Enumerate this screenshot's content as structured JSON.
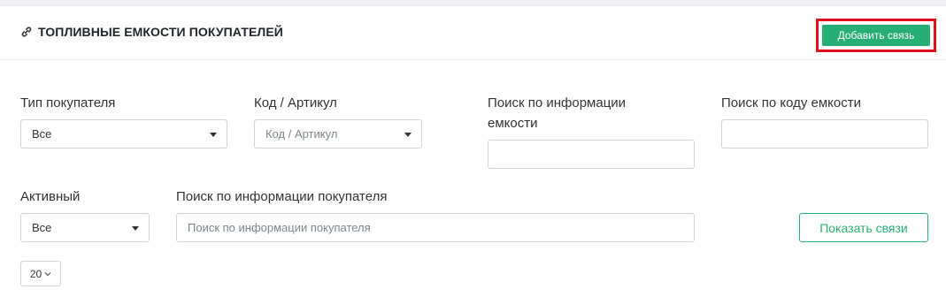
{
  "header": {
    "title": "ТОПЛИВНЫЕ ЕМКОСТИ ПОКУПАТЕЛЕЙ",
    "title_icon": "link-icon",
    "add_button_label": "Добавить связь"
  },
  "filters": {
    "buyer_type": {
      "label": "Тип покупателя",
      "value": "Все"
    },
    "code": {
      "label": "Код / Артикул",
      "placeholder": "Код / Артикул"
    },
    "tank_info": {
      "label_line1": "Поиск по информации",
      "label_line2": "емкости",
      "value": ""
    },
    "tank_code": {
      "label": "Поиск по коду емкости",
      "value": ""
    },
    "active": {
      "label": "Активный",
      "value": "Все"
    },
    "buyer_info": {
      "label": "Поиск по информации покупателя",
      "placeholder": "Поиск по информации покупателя"
    }
  },
  "actions": {
    "show_button_label": "Показать связи"
  },
  "pagination": {
    "page_size": "20"
  },
  "colors": {
    "accent": "#27ae74",
    "highlight": "#e3101a"
  }
}
